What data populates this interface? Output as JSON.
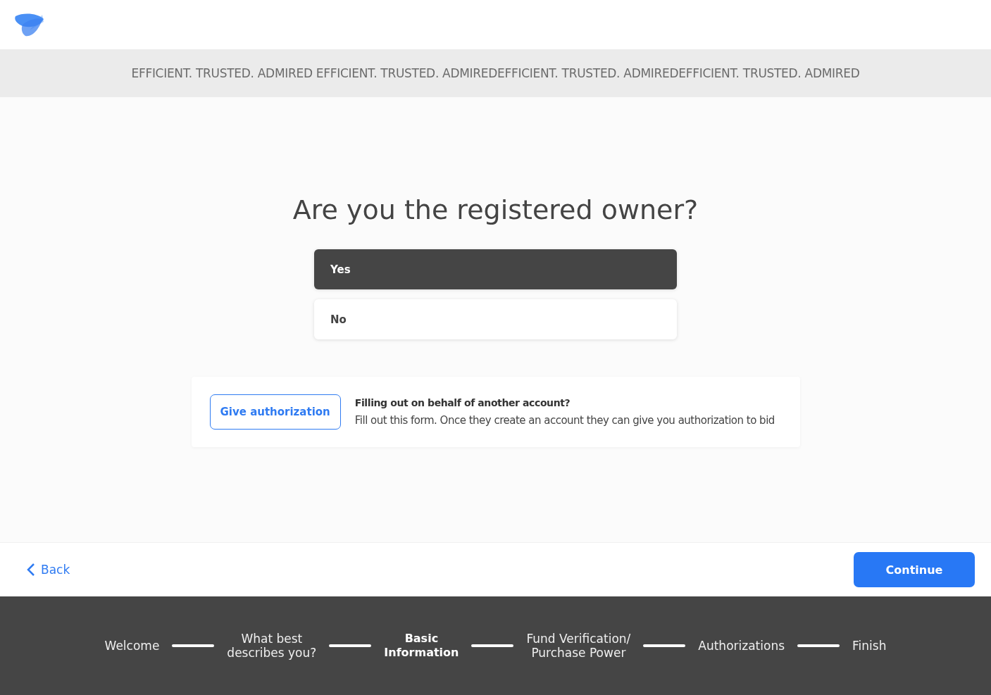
{
  "tagline": "EFFICIENT. TRUSTED. ADMIRED EFFICIENT. TRUSTED. ADMIREDEFFICIENT. TRUSTED. ADMIREDEFFICIENT. TRUSTED. ADMIRED",
  "question": "Are you the registered owner?",
  "options": [
    {
      "label": "Yes",
      "selected": true
    },
    {
      "label": "No",
      "selected": false
    }
  ],
  "authorization": {
    "button": "Give authorization",
    "title": "Filling out on behalf of another account?",
    "text": "Fill out this form. Once they create an account they can give you authorization to bid"
  },
  "nav": {
    "back": "Back",
    "continue": "Continue"
  },
  "steps": [
    {
      "label": "Welcome",
      "selected": false
    },
    {
      "label": "What best\ndescribes you?",
      "selected": false
    },
    {
      "label": "Basic\nInformation",
      "selected": true
    },
    {
      "label": "Fund Verification/\nPurchase Power",
      "selected": false
    },
    {
      "label": "Authorizations",
      "selected": false
    },
    {
      "label": "Finish",
      "selected": false
    }
  ]
}
